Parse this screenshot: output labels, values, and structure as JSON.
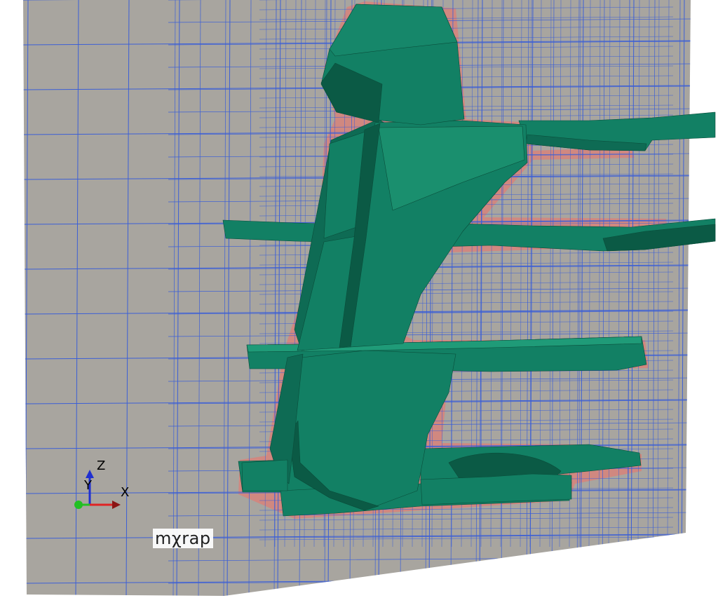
{
  "viewport": {
    "watermark": "mχrap",
    "axes": {
      "x_label": "X",
      "y_label": "Y",
      "z_label": "Z"
    },
    "colors": {
      "background": "#ffffff",
      "slice_plane": "#a8a59f",
      "mesh_lines": "#3c5fd6",
      "refinement_halo": "#d7837a",
      "surface": "#128064",
      "surface_dark": "#0b5a45",
      "surface_light": "#1f9b78",
      "x_axis": "#e02424",
      "y_axis": "#22c022",
      "z_axis": "#1f2fd0"
    },
    "icons": [
      "axes-triad-icon"
    ]
  }
}
